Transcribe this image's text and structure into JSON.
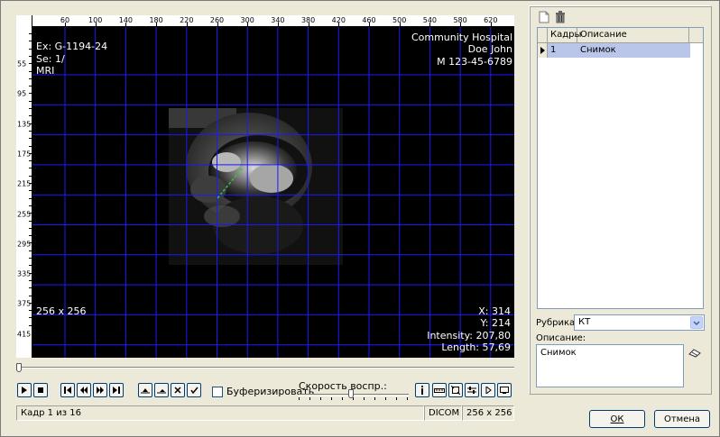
{
  "viewer": {
    "ruler_x_ticks": [
      "60",
      "100",
      "140",
      "180",
      "220",
      "260",
      "300",
      "340",
      "380",
      "420",
      "460",
      "500",
      "540",
      "580",
      "620"
    ],
    "ruler_y_ticks": [
      "55",
      "95",
      "135",
      "175",
      "215",
      "255",
      "295",
      "335",
      "375",
      "415"
    ],
    "overlay": {
      "exam": "Ex: G-1194-24",
      "series": "Se: 1/",
      "modality": "MRI",
      "hospital": "Community Hospital",
      "patient_name": "Doe John",
      "patient_id": "M 123-45-6789",
      "matrix": "256 x 256",
      "x_readout": "X: 314",
      "y_readout": "Y: 214",
      "intensity": "Intensity: 207,80",
      "length": "Length: 57,69"
    },
    "grid_color": "#1a1aff",
    "timeline_position": 0.0
  },
  "transport": {
    "buffer_label": "Буферизировать",
    "speed_label": "Скорость воспр.:",
    "speed_level": 0.47
  },
  "status": {
    "frame": "Кадр 1 из 16",
    "format": "DICOM",
    "size": "256 x 256"
  },
  "frames_panel": {
    "columns": [
      "Кадры",
      "Описание"
    ],
    "rows": [
      {
        "frame": "1",
        "description": "Снимок"
      }
    ],
    "selected_color": "#b9c6e9"
  },
  "form": {
    "rubric_label": "Рубрика:",
    "rubric_value": "КТ",
    "description_label": "Описание:",
    "description_value": "Снимок"
  },
  "buttons": {
    "ok": "ОК",
    "cancel": "Отмена"
  }
}
